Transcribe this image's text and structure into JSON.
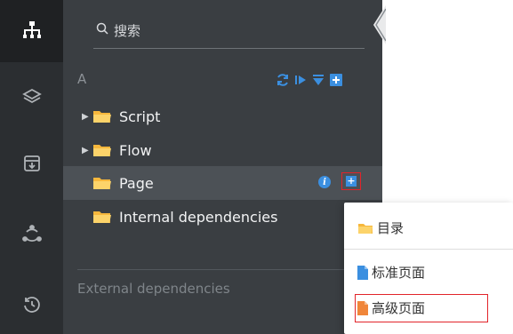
{
  "search": {
    "placeholder": "搜索"
  },
  "tree": {
    "group_a": "A",
    "items": [
      {
        "label": "Script",
        "expandable": true
      },
      {
        "label": "Flow",
        "expandable": true
      },
      {
        "label": "Page",
        "expandable": false,
        "selected": true
      },
      {
        "label": "Internal dependencies",
        "expandable": false
      }
    ],
    "external_label": "External dependencies"
  },
  "context_menu": {
    "items": [
      {
        "label": "目录",
        "icon": "folder-icon"
      },
      {
        "label": "标准页面",
        "icon": "blue-file-icon"
      },
      {
        "label": "高级页面",
        "icon": "orange-file-icon",
        "highlighted": true
      }
    ]
  },
  "colors": {
    "accent_blue": "#3b8fe0",
    "folder_yellow": "#f6b73c",
    "highlight_red": "#e2242a"
  }
}
